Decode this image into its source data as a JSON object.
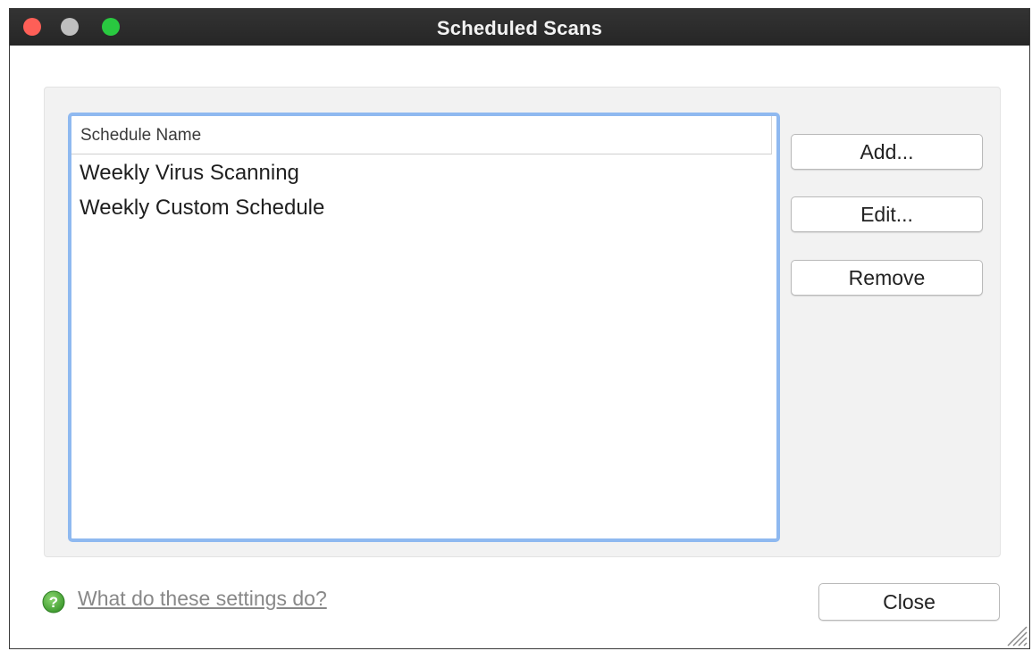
{
  "window": {
    "title": "Scheduled Scans"
  },
  "list": {
    "column_header": "Schedule Name",
    "items": [
      "Weekly Virus Scanning",
      "Weekly Custom Schedule"
    ]
  },
  "buttons": {
    "add": "Add...",
    "edit": "Edit...",
    "remove": "Remove",
    "close": "Close"
  },
  "help": {
    "link_text": "What do these settings do?",
    "icon": "help-question-icon"
  },
  "colors": {
    "titlebar": "#2b2b2b",
    "focus_ring": "#8fb9f0",
    "help_icon": "#4caf3f",
    "traffic_close": "#fe5f57",
    "traffic_min": "#bfbfbf",
    "traffic_zoom": "#29c940"
  }
}
